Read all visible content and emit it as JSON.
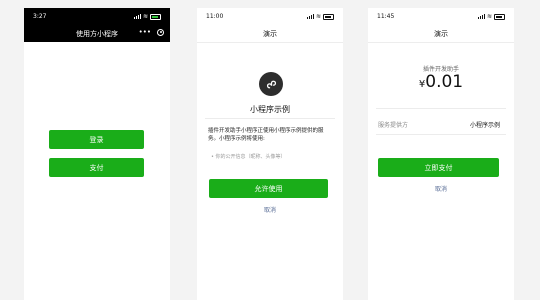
{
  "colors": {
    "wechat_green": "#1aad19",
    "link_blue": "#576b95",
    "background": "#f3f3f3"
  },
  "screens": [
    {
      "status_time": "3:27",
      "title": "使用方小程序",
      "capsule_more": "•••",
      "buttons": [
        "登录",
        "支付"
      ]
    },
    {
      "status_time": "11:00",
      "title": "演示",
      "app_icon": "mini-program-icon",
      "app_name": "小程序示例",
      "description": "插件开发助手小程序正使用小程序示例提供的服务。小程序示例将使用:",
      "permission": "• 你的公开信息（昵称、头像等）",
      "primary_button": "允许使用",
      "cancel": "取消"
    },
    {
      "status_time": "11:45",
      "title": "演示",
      "payee": "插件开发助手",
      "currency": "¥",
      "amount": "0.01",
      "provider_label": "服务提供方",
      "provider_value": "小程序示例",
      "pay_button": "立即支付",
      "cancel": "取消"
    }
  ]
}
